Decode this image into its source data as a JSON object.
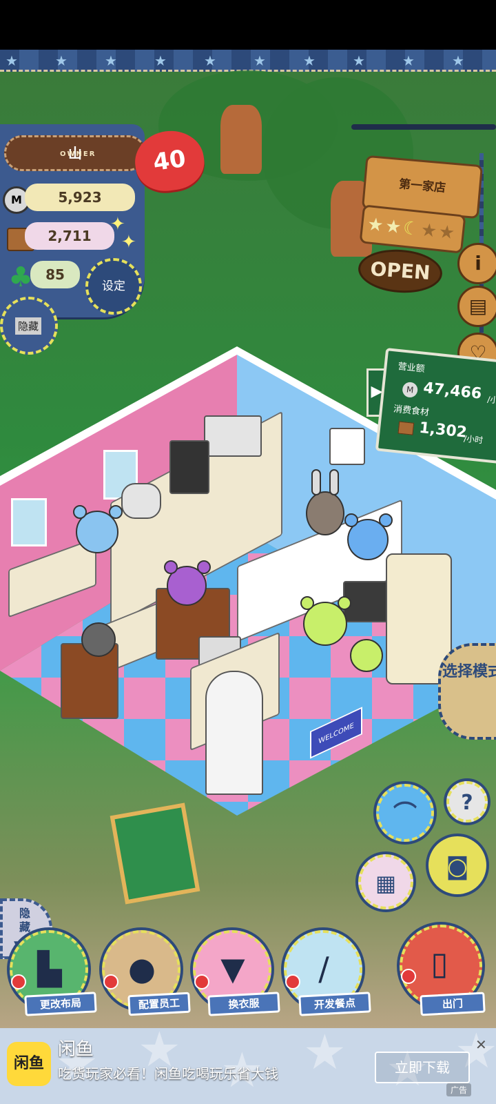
{
  "owner": {
    "caption": "OWNER",
    "name": "山",
    "level": "40"
  },
  "stats": {
    "coins": "5,923",
    "ingredients": "2,711",
    "clovers": "85"
  },
  "buttons": {
    "settings": "设定",
    "hide_top": "隐藏",
    "hide_bottom": "隐藏",
    "select_mode": "选择模式"
  },
  "shop": {
    "name": "第一家店",
    "open": "OPEN",
    "rating_stars": 2.5
  },
  "revenue": {
    "sales_label": "营业额",
    "sales_value": "47,466",
    "sales_unit": "/小时",
    "consumed_label": "消费食材",
    "consumed_value": "1,302",
    "consumed_unit": "/小时"
  },
  "side_icons": [
    "info-icon",
    "recipe-book-icon",
    "heart-bubble-icon"
  ],
  "room": {
    "mat_text": "WELCOME"
  },
  "bottom_menu": [
    {
      "label": "更改布局",
      "icon": "table-icon"
    },
    {
      "label": "配置员工",
      "icon": "bear-face-icon"
    },
    {
      "label": "换衣服",
      "icon": "shirt-icon"
    },
    {
      "label": "开发餐点",
      "icon": "knife-icon"
    },
    {
      "label": "出门",
      "icon": "door-icon"
    }
  ],
  "action_buttons": [
    "hat-icon",
    "help-icon",
    "gallery-icon",
    "camera-icon"
  ],
  "ad": {
    "logo_text": "闲鱼",
    "title": "闲鱼",
    "description": "吃货玩家必看！闲鱼吃喝玩乐省大钱",
    "cta": "立即下载",
    "tag": "广告",
    "close": "✕"
  },
  "colors": {
    "wall_pink": "#e77fb0",
    "wall_blue": "#8cc8f4",
    "accent_navy": "#2d4a7a",
    "heart_red": "#e23a3a"
  }
}
